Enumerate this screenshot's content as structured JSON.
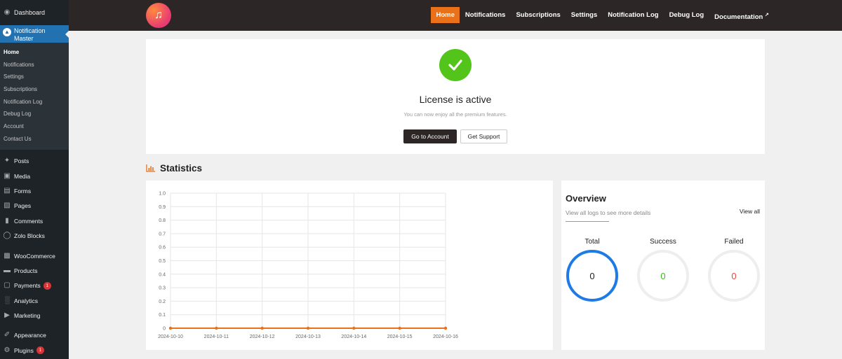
{
  "sidebar": {
    "dashboard": "Dashboard",
    "active_plugin": "Notification Master",
    "submenu": [
      "Home",
      "Notifications",
      "Settings",
      "Subscriptions",
      "Notification Log",
      "Debug Log",
      "Account",
      "Contact Us"
    ],
    "menu": [
      {
        "label": "Posts",
        "icon": "pin-icon"
      },
      {
        "label": "Media",
        "icon": "media-icon"
      },
      {
        "label": "Forms",
        "icon": "forms-icon"
      },
      {
        "label": "Pages",
        "icon": "pages-icon"
      },
      {
        "label": "Comments",
        "icon": "comment-icon"
      },
      {
        "label": "Zolo Blocks",
        "icon": "zolo-icon"
      },
      {
        "label": "WooCommerce",
        "icon": "woo-icon"
      },
      {
        "label": "Products",
        "icon": "products-icon"
      },
      {
        "label": "Payments",
        "icon": "payments-icon",
        "badge": "1"
      },
      {
        "label": "Analytics",
        "icon": "analytics-icon"
      },
      {
        "label": "Marketing",
        "icon": "marketing-icon"
      },
      {
        "label": "Appearance",
        "icon": "brush-icon"
      },
      {
        "label": "Plugins",
        "icon": "plugin-icon",
        "badge": "1"
      }
    ]
  },
  "topnav": {
    "links": [
      "Home",
      "Notifications",
      "Subscriptions",
      "Settings",
      "Notification Log",
      "Debug Log",
      "Documentation"
    ],
    "active": "Home",
    "accent": "#e8711a"
  },
  "license": {
    "title": "License is active",
    "subtitle": "You can now enjoy all the premium features.",
    "primary_button": "Go to Account",
    "secondary_button": "Get Support"
  },
  "statistics": {
    "heading": "Statistics"
  },
  "chart_data": {
    "type": "line",
    "title": "",
    "xlabel": "",
    "ylabel": "",
    "categories": [
      "2024-10-10",
      "2024-10-11",
      "2024-10-12",
      "2024-10-13",
      "2024-10-14",
      "2024-10-15",
      "2024-10-16"
    ],
    "series": [
      {
        "values": [
          0,
          0,
          0,
          0,
          0,
          0,
          0
        ],
        "color": "#e8711a"
      }
    ],
    "ylim": [
      0,
      1
    ],
    "yticks": [
      "1.0",
      "0.9",
      "0.8",
      "0.7",
      "0.6",
      "0.5",
      "0.4",
      "0.3",
      "0.2",
      "0.1",
      "0"
    ],
    "grid": true
  },
  "overview": {
    "title": "Overview",
    "subtitle": "View all logs to see more details",
    "view_all": "View all",
    "stats": [
      {
        "label": "Total",
        "value": "0"
      },
      {
        "label": "Success",
        "value": "0"
      },
      {
        "label": "Failed",
        "value": "0"
      }
    ]
  }
}
